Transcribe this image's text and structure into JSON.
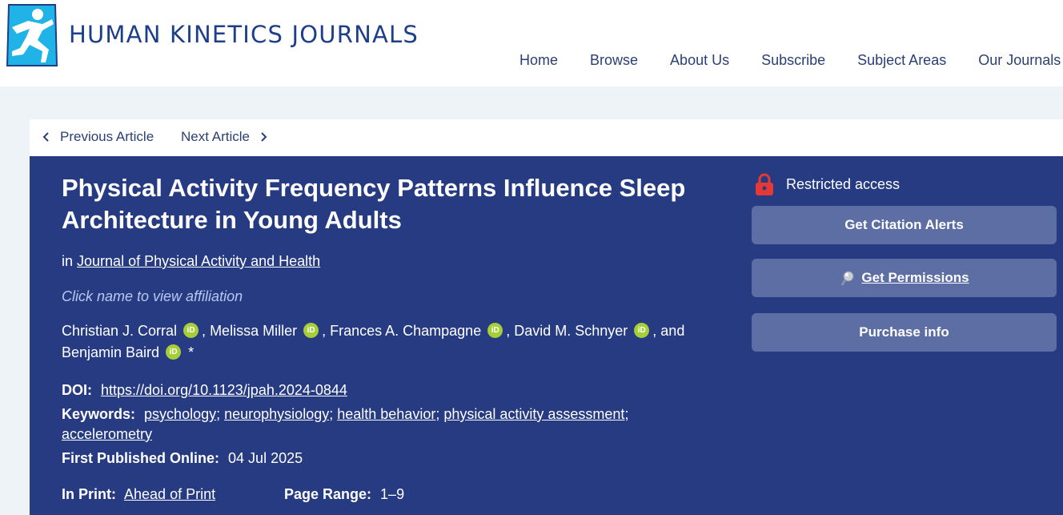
{
  "header": {
    "logo_text": "HUMAN KINETICS JOURNALS",
    "logo_icon": "runner-logo-icon",
    "nav": [
      "Home",
      "Browse",
      "About Us",
      "Subscribe",
      "Subject Areas",
      "Our Journals"
    ]
  },
  "subnav": {
    "prev_label": "Previous Article",
    "next_label": "Next Article"
  },
  "article": {
    "title": "Physical Activity Frequency Patterns Influence Sleep Architecture in Young Adults",
    "in_label": "in",
    "journal": "Journal of Physical Activity and Health",
    "affiliation_hint": "Click name to view affiliation",
    "authors": [
      "Christian J. Corral",
      "Melissa Miller",
      "Frances A. Champagne",
      "David M. Schnyer",
      "Benjamin Baird"
    ],
    "authors_and": "and",
    "orcid_label": "iD",
    "corresponding_mark": "*",
    "doi_label": "DOI:",
    "doi": "https://doi.org/10.1123/jpah.2024-0844",
    "keywords_label": "Keywords:",
    "keywords": [
      "psychology",
      "neurophysiology",
      "health behavior",
      "physical activity assessment",
      "accelerometry"
    ],
    "published_label": "First Published Online:",
    "published": "04 Jul 2025",
    "print_label": "In Print:",
    "print_value": "Ahead of Print",
    "page_range_label": "Page Range:",
    "page_range": "1–9"
  },
  "sidebar": {
    "access": "Restricted access",
    "citation_alerts": "Get Citation Alerts",
    "permissions": "Get Permissions",
    "purchase": "Purchase info"
  },
  "colors": {
    "panel": "#263b82",
    "button": "#5d6ea5",
    "brand": "#1d3f8a",
    "logo_cyan": "#1fb3e8",
    "lock_red": "#e53935",
    "orcid_green": "#a6ce39"
  }
}
